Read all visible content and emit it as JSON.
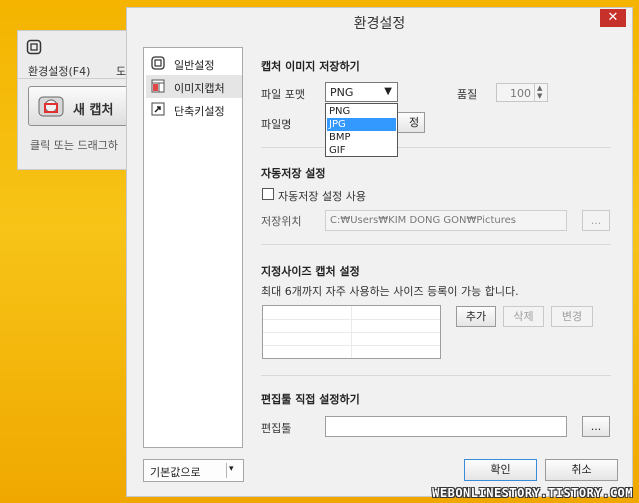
{
  "background_app": {
    "menu": [
      "환경설정(F4)",
      "도"
    ],
    "capture_button": "새 캡처",
    "hint": "클릭 또는 드래그하"
  },
  "dialog": {
    "title": "환경설정",
    "close_symbol": "✕",
    "nav": [
      {
        "label": "일반설정",
        "icon": "general-settings-icon"
      },
      {
        "label": "이미지캡처",
        "icon": "image-capture-icon"
      },
      {
        "label": "단축키설정",
        "icon": "shortcut-key-icon"
      }
    ],
    "default_button": "기본값으로",
    "default_button_arrow": "▾",
    "save_image": {
      "title": "캡처 이미지 저장하기",
      "format_label": "파일 포맷",
      "format_value": "PNG",
      "format_options": [
        "PNG",
        "JPG",
        "BMP",
        "GIF"
      ],
      "format_highlighted": "JPG",
      "quality_label": "품질",
      "quality_value": "100",
      "filename_label": "파일명",
      "filename_button_fragment": "정"
    },
    "autosave": {
      "title": "자동저장 설정",
      "checkbox_label": "자동저장 설정 사용",
      "location_label": "저장위치",
      "location_value": "C:₩Users₩KIM DONG GON₩Pictures",
      "browse": "..."
    },
    "preset_size": {
      "title": "지정사이즈 캡처 설정",
      "description": "최대 6개까지 자주 사용하는 사이즈 등록이 가능 합니다.",
      "add": "추가",
      "delete": "삭제",
      "edit": "변경"
    },
    "editor": {
      "title": "편집툴 직접 설정하기",
      "label": "편집툴",
      "browse": "..."
    },
    "ok": "확인",
    "cancel": "취소"
  },
  "watermark": "WEBONLINESTORY.TISTORY.COM",
  "colors": {
    "desktop_yellow": "#f4b400",
    "close_red": "#c7312c",
    "selection_blue": "#3399ff"
  }
}
